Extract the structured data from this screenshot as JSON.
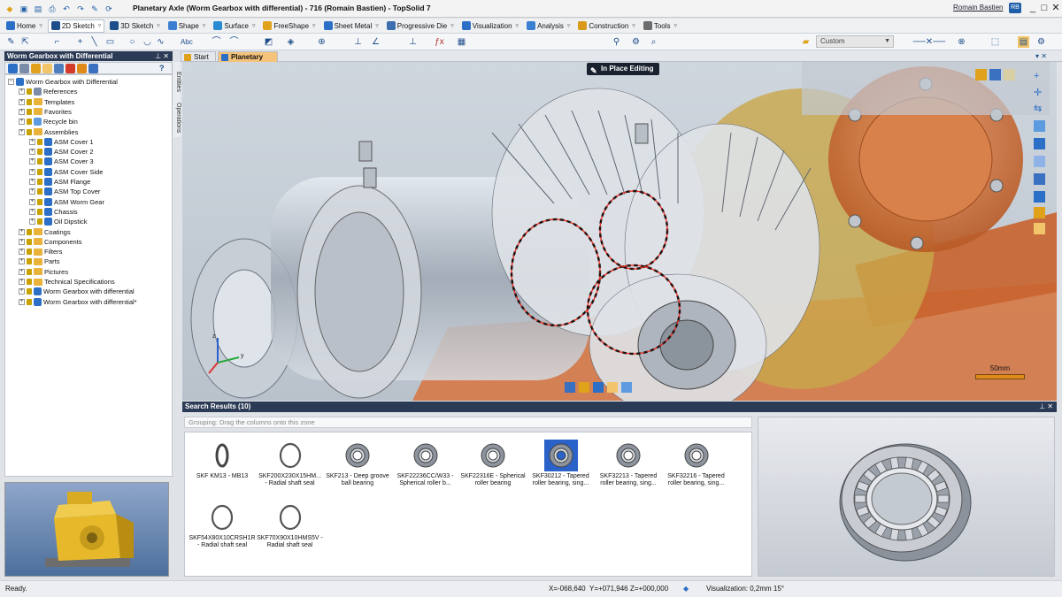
{
  "window": {
    "title": "Planetary Axle (Worm Gearbox with differential) - 716 (Romain Bastien) - TopSolid 7",
    "user": "Romain Bastien",
    "user_badge": "RB"
  },
  "menus": [
    {
      "label": "Home",
      "color": "#2c6fc7"
    },
    {
      "label": "2D Sketch",
      "color": "#1d4d8a",
      "active": true
    },
    {
      "label": "3D Sketch",
      "color": "#1d4d8a"
    },
    {
      "label": "Shape",
      "color": "#3b7fd1"
    },
    {
      "label": "Surface",
      "color": "#2a8ad4"
    },
    {
      "label": "FreeShape",
      "color": "#e0a21b"
    },
    {
      "label": "Sheet Metal",
      "color": "#2c6fc7"
    },
    {
      "label": "Progressive Die",
      "color": "#3d6fb0"
    },
    {
      "label": "Visualization",
      "color": "#2c6fc7"
    },
    {
      "label": "Analysis",
      "color": "#3b7fd1"
    },
    {
      "label": "Construction",
      "color": "#d99a1c"
    },
    {
      "label": "Tools",
      "color": "#6c6c6c"
    }
  ],
  "toolbar": {
    "style_combo": "Custom"
  },
  "tree_panel": {
    "title": "Worm Gearbox with Differential",
    "nodes": [
      {
        "label": "Worm Gearbox with Differential",
        "level": 0,
        "icon": "project"
      },
      {
        "label": "References",
        "level": 1,
        "icon": "references"
      },
      {
        "label": "Templates",
        "level": 1,
        "icon": "folder"
      },
      {
        "label": "Favorites",
        "level": 1,
        "icon": "folder"
      },
      {
        "label": "Recycle bin",
        "level": 1,
        "icon": "recycle"
      },
      {
        "label": "Assemblies",
        "level": 1,
        "icon": "folder"
      },
      {
        "label": "ASM Cover 1",
        "level": 2,
        "icon": "asm"
      },
      {
        "label": "ASM Cover 2",
        "level": 2,
        "icon": "asm"
      },
      {
        "label": "ASM Cover 3",
        "level": 2,
        "icon": "asm"
      },
      {
        "label": "ASM Cover Side",
        "level": 2,
        "icon": "asm"
      },
      {
        "label": "ASM Flange",
        "level": 2,
        "icon": "asm"
      },
      {
        "label": "ASM Top Cover",
        "level": 2,
        "icon": "asm"
      },
      {
        "label": "ASM Worm Gear",
        "level": 2,
        "icon": "asm"
      },
      {
        "label": "Chassis",
        "level": 2,
        "icon": "asm"
      },
      {
        "label": "Oil Dipstick",
        "level": 2,
        "icon": "asm"
      },
      {
        "label": "Coatings",
        "level": 1,
        "icon": "folder"
      },
      {
        "label": "Components",
        "level": 1,
        "icon": "folder"
      },
      {
        "label": "Filters",
        "level": 1,
        "icon": "folder"
      },
      {
        "label": "Parts",
        "level": 1,
        "icon": "folder"
      },
      {
        "label": "Pictures",
        "level": 1,
        "icon": "folder"
      },
      {
        "label": "Technical Specifications",
        "level": 1,
        "icon": "folder"
      },
      {
        "label": "Worm Gearbox with differential",
        "level": 1,
        "icon": "asm"
      },
      {
        "label": "Worm Gearbox with differential*",
        "level": 1,
        "icon": "asm"
      }
    ]
  },
  "side_tabs": [
    "Entities",
    "Operations"
  ],
  "doc_tabs": [
    {
      "label": "Start Page",
      "active": false
    },
    {
      "label": "Planetary Axle",
      "active": true
    }
  ],
  "viewport": {
    "mode_badge": "In Place Editing",
    "scale_label": "50mm"
  },
  "search_results": {
    "title": "Search Results (10)",
    "grouping_hint": "Grouping: Drag the columns onto this zone",
    "items": [
      {
        "line1": "SKF KM13 - MB13",
        "line2": "",
        "kind": "nut"
      },
      {
        "line1": "SKF200X230X15HM...",
        "line2": "- Radial shaft seal",
        "kind": "seal"
      },
      {
        "line1": "SKF213 - Deep groove",
        "line2": "ball bearing",
        "kind": "bearing"
      },
      {
        "line1": "SKF22236CC/W33 -",
        "line2": "Spherical roller b...",
        "kind": "bearing"
      },
      {
        "line1": "SKF22316E - Spherical",
        "line2": "roller bearing",
        "kind": "bearing"
      },
      {
        "line1": "SKF30212 - Tapered",
        "line2": "roller bearing, sing...",
        "kind": "bearing",
        "selected": true
      },
      {
        "line1": "SKF32213 - Tapered",
        "line2": "roller bearing, sing...",
        "kind": "bearing"
      },
      {
        "line1": "SKF32216 - Tapered",
        "line2": "roller bearing, sing...",
        "kind": "bearing"
      },
      {
        "line1": "SKF54X80X10CRSH1R",
        "line2": "- Radial shaft seal",
        "kind": "seal"
      },
      {
        "line1": "SKF70X90X10HMS5V -",
        "line2": "Radial shaft seal",
        "kind": "seal"
      }
    ]
  },
  "status": {
    "text": "Ready.",
    "x": "X=-068,640",
    "y": "Y=+071,946",
    "z": "Z=+000,000",
    "visualization": "Visualization: 0,2mm 15°"
  },
  "colors": {
    "panel_header": "#2b3a55",
    "active_tab": "#f5c37a",
    "housing_orange": "#d7743e",
    "gear_gold": "#c9a84a",
    "selection_blue": "#2a62c9"
  }
}
